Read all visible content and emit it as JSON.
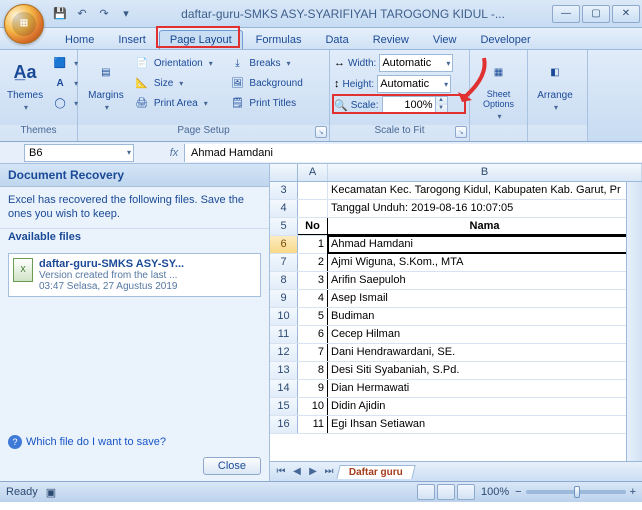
{
  "title": "daftar-guru-SMKS ASY-SYARIFIYAH TAROGONG KIDUL -...",
  "qat": {
    "save": "💾",
    "undo": "↶",
    "redo": "↷",
    "more": "▾"
  },
  "winbtns": {
    "min": "—",
    "max": "▢",
    "close": "✕"
  },
  "tabs": [
    "Home",
    "Insert",
    "Page Layout",
    "Formulas",
    "Data",
    "Review",
    "View",
    "Developer"
  ],
  "active_tab_index": 2,
  "ribbon": {
    "themes": {
      "label": "Themes",
      "themes_btn": "Themes",
      "colors": "",
      "fonts": "A",
      "effects": ""
    },
    "page_setup": {
      "label": "Page Setup",
      "margins": "Margins",
      "orientation": "Orientation",
      "size": "Size",
      "print_area": "Print Area",
      "breaks": "Breaks",
      "background": "Background",
      "print_titles": "Print Titles"
    },
    "scale": {
      "label": "Scale to Fit",
      "width_lbl": "Width:",
      "width_val": "Automatic",
      "height_lbl": "Height:",
      "height_val": "Automatic",
      "scale_lbl": "Scale:",
      "scale_val": "100%"
    },
    "sheet_options": {
      "label": "Sheet Options",
      "btn": "Sheet Options"
    },
    "arrange": {
      "label": "Arrange",
      "btn": "Arrange"
    }
  },
  "namebox": "B6",
  "formula": "Ahmad Hamdani",
  "doc_recovery": {
    "title": "Document Recovery",
    "msg": "Excel has recovered the following files.  Save the ones you wish to keep.",
    "avail": "Available files",
    "file_title": "daftar-guru-SMKS ASY-SY...",
    "file_sub1": "Version created from the last ...",
    "file_sub2": "03:47 Selasa, 27 Agustus 2019",
    "question": "Which file do I want to save?",
    "close": "Close"
  },
  "sheet": {
    "columns": [
      "A",
      "B"
    ],
    "meta_rows": [
      {
        "r": 3,
        "text": "Kecamatan Kec. Tarogong Kidul, Kabupaten Kab. Garut, Pr"
      },
      {
        "r": 4,
        "text": "Tanggal Unduh: 2019-08-16 10:07:05"
      }
    ],
    "header_row": {
      "r": 5,
      "no": "No",
      "nama": "Nama"
    },
    "selected_row": 6,
    "data": [
      {
        "r": 6,
        "no": 1,
        "nama": "Ahmad Hamdani"
      },
      {
        "r": 7,
        "no": 2,
        "nama": "Ajmi Wiguna, S.Kom., MTA"
      },
      {
        "r": 8,
        "no": 3,
        "nama": "Arifin Saepuloh"
      },
      {
        "r": 9,
        "no": 4,
        "nama": "Asep Ismail"
      },
      {
        "r": 10,
        "no": 5,
        "nama": "Budiman"
      },
      {
        "r": 11,
        "no": 6,
        "nama": "Cecep Hilman"
      },
      {
        "r": 12,
        "no": 7,
        "nama": "Dani Hendrawardani, SE."
      },
      {
        "r": 13,
        "no": 8,
        "nama": "Desi Siti Syabaniah, S.Pd."
      },
      {
        "r": 14,
        "no": 9,
        "nama": "Dian Hermawati"
      },
      {
        "r": 15,
        "no": 10,
        "nama": "Didin Ajidin"
      },
      {
        "r": 16,
        "no": 11,
        "nama": "Egi Ihsan Setiawan"
      }
    ],
    "tab_name": "Daftar guru"
  },
  "status": {
    "ready": "Ready",
    "zoom": "100%"
  }
}
